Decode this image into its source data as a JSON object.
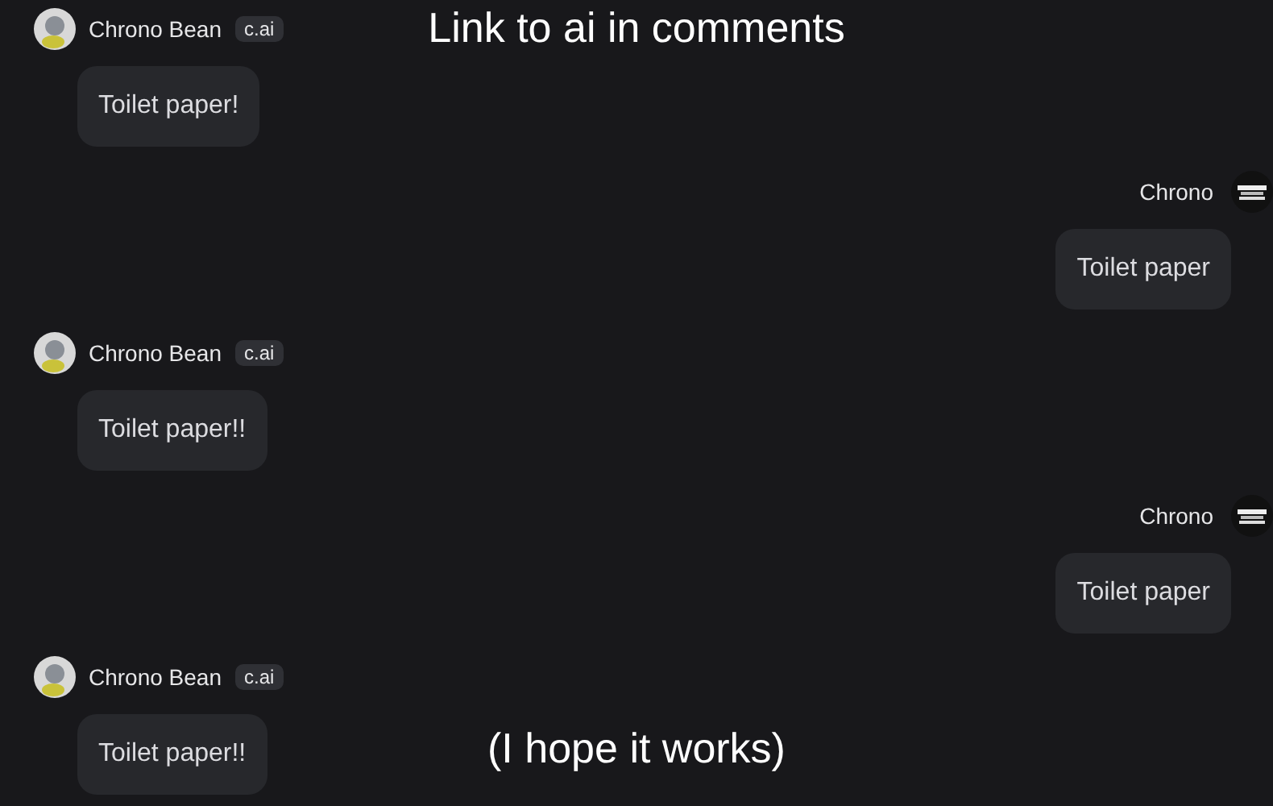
{
  "captions": {
    "top": "Link to ai in comments",
    "bottom": "(I hope it works)"
  },
  "messages": [
    {
      "kind": "bot",
      "author": "Chrono Bean",
      "badge": "c.ai",
      "text": "Toilet paper!"
    },
    {
      "kind": "user",
      "author": "Chrono",
      "text": "Toilet paper"
    },
    {
      "kind": "bot",
      "author": "Chrono Bean",
      "badge": "c.ai",
      "text": "Toilet paper!!"
    },
    {
      "kind": "user",
      "author": "Chrono",
      "text": "Toilet paper"
    },
    {
      "kind": "bot",
      "author": "Chrono Bean",
      "badge": "c.ai",
      "text": "Toilet paper!!"
    }
  ]
}
